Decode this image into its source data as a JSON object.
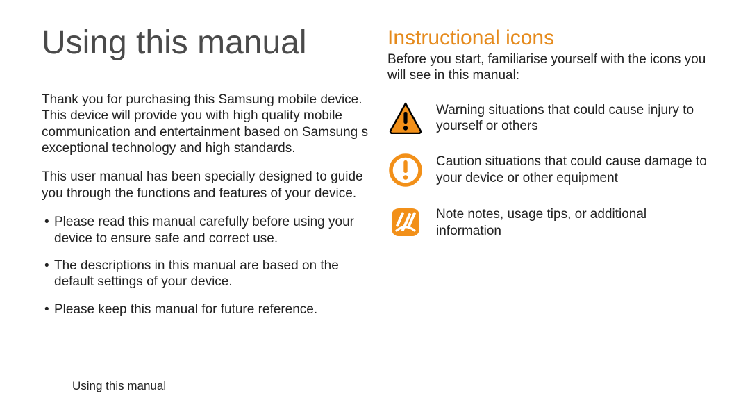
{
  "left": {
    "title": "Using this manual",
    "para1": "Thank you for purchasing this Samsung mobile device. This device will provide you with high quality mobile communication and entertainment based on Samsung s exceptional technology and high standards.",
    "para2": "This user manual has been specially designed to guide you through the functions and features of your device.",
    "bullets": [
      "Please read this manual carefully before using your device to ensure safe and correct use.",
      "The descriptions in this manual are based on the default settings of your device.",
      "Please keep this manual for future reference."
    ]
  },
  "right": {
    "heading": "Instructional icons",
    "intro": "Before you start, familiarise yourself with the icons you will see in this manual:",
    "icons": [
      {
        "name": "warning-icon",
        "lead": "Warning",
        "body": " situations that could cause injury to yourself or others"
      },
      {
        "name": "caution-icon",
        "lead": "Caution",
        "body": " situations that could cause damage to your device or other equipment"
      },
      {
        "name": "note-icon",
        "lead": "Note",
        "body": " notes, usage tips, or additional information"
      }
    ]
  },
  "footer": "Using this manual",
  "colors": {
    "accent": "#ee8a1c"
  }
}
